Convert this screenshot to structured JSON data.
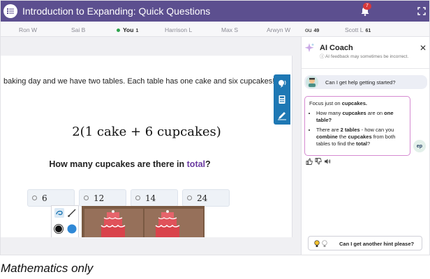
{
  "header": {
    "title": "Introduction to Expanding: Quick Questions",
    "notification_count": "7"
  },
  "students": [
    {
      "name": "Ron W",
      "score": ""
    },
    {
      "name": "Sai B",
      "score": ""
    },
    {
      "name": "You",
      "score": "1"
    },
    {
      "name": "Harrison L",
      "score": ""
    },
    {
      "name": "Max S",
      "score": ""
    },
    {
      "name": "Arwyn W",
      "score": ""
    },
    {
      "name": "ou",
      "score": "49"
    },
    {
      "name": "Scott L",
      "score": "61"
    }
  ],
  "question": {
    "story": "baking day and we have two tables. Each table has one cake and six cupcakes!",
    "expression": "2(1 cake + 6 cupcakes)",
    "prompt_before": "How many cupcakes are there in ",
    "prompt_highlight": "total",
    "prompt_after": "?",
    "options": [
      "6",
      "12",
      "14",
      "24"
    ]
  },
  "coach": {
    "title": "AI Coach",
    "note": "AI feedback may sometimes be incorrect.",
    "user_message": "Can I get help getting started?",
    "bot_intro_before": "Focus just on ",
    "bot_intro_bold": "cupcakes.",
    "bullet1": {
      "a": "How many ",
      "b": "cupcakes",
      "c": " are on ",
      "d": "one table?"
    },
    "bullet2": {
      "a": "There are ",
      "b": "2 tables",
      "c": " - how can you ",
      "d": "combine",
      "e": " the ",
      "f": "cupcakes",
      "g": " from both tables to find the ",
      "h": "total",
      "i": "?"
    },
    "bot_avatar": "ep",
    "hint_button": "Can I get another hint please?"
  },
  "caption": "Mathematics only",
  "colors": {
    "header_bg": "#5c4f8f",
    "highlight": "#6a3aa0",
    "tool_strip": "#1e78b4",
    "bot_border": "#d58ad1"
  },
  "icons": [
    "menu-list-icon",
    "bell-icon",
    "fullscreen-icon",
    "read-aloud-icon",
    "calculator-icon",
    "pen-icon",
    "sparkle-icon",
    "close-icon",
    "thumbs-up-icon",
    "thumbs-down-icon",
    "speaker-icon",
    "lightbulb-icon"
  ]
}
